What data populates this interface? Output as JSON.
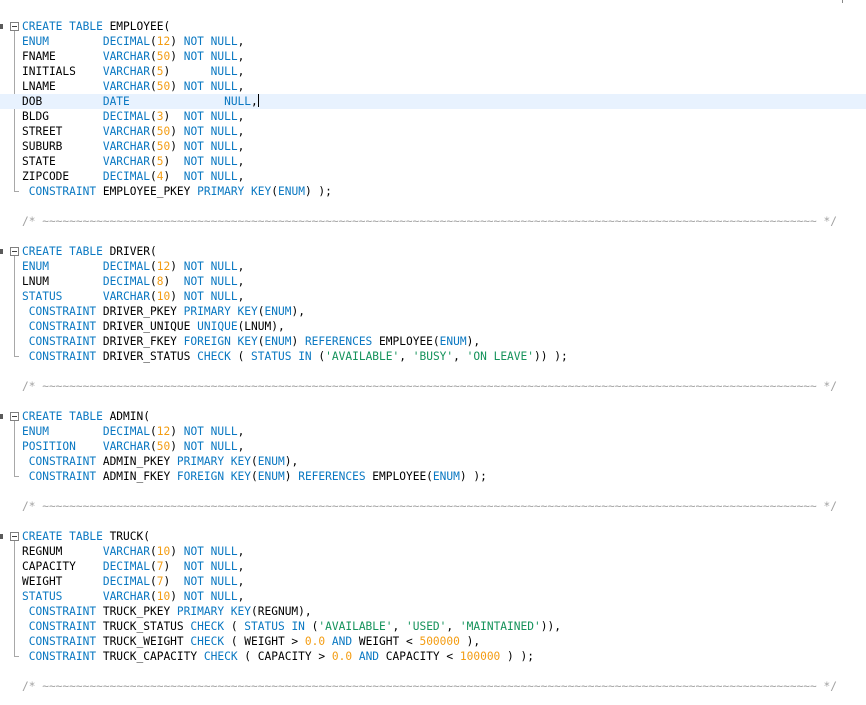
{
  "editor": {
    "language": "sql",
    "colors": {
      "keyword": "#0a78c2",
      "number": "#f39c12",
      "string": "#14925a",
      "comment": "#a0a0a0",
      "current_line": "#e8f2fe",
      "text": "#000000",
      "background": "#ffffff"
    },
    "cursor": {
      "line": 6,
      "after_text": "NOT NULL,"
    },
    "lines": [
      [
        [
          "CREATE TABLE",
          "kw"
        ],
        [
          " EMPLOYEE(",
          ""
        ]
      ],
      [
        [
          "ENUM        ",
          "kw"
        ],
        [
          "DECIMAL",
          "kw"
        ],
        [
          "(",
          ""
        ],
        [
          "12",
          "num"
        ],
        [
          ") ",
          ""
        ],
        [
          "NOT NULL",
          "kw"
        ],
        [
          ",",
          ""
        ]
      ],
      [
        [
          "FNAME       ",
          ""
        ],
        [
          "VARCHAR",
          "kw"
        ],
        [
          "(",
          ""
        ],
        [
          "50",
          "num"
        ],
        [
          ") ",
          ""
        ],
        [
          "NOT NULL",
          "kw"
        ],
        [
          ",",
          ""
        ]
      ],
      [
        [
          "INITIALS    ",
          ""
        ],
        [
          "VARCHAR",
          "kw"
        ],
        [
          "(",
          ""
        ],
        [
          "5",
          "num"
        ],
        [
          ")      ",
          ""
        ],
        [
          "NULL",
          "kw"
        ],
        [
          ",",
          ""
        ]
      ],
      [
        [
          "LNAME       ",
          ""
        ],
        [
          "VARCHAR",
          "kw"
        ],
        [
          "(",
          ""
        ],
        [
          "50",
          "num"
        ],
        [
          ") ",
          ""
        ],
        [
          "NOT NULL",
          "kw"
        ],
        [
          ",",
          ""
        ]
      ],
      [
        [
          "DOB         ",
          ""
        ],
        [
          "DATE",
          "kw"
        ],
        [
          "              ",
          ""
        ],
        [
          "NULL",
          "kw"
        ],
        [
          ",",
          ""
        ]
      ],
      [
        [
          "BLDG        ",
          ""
        ],
        [
          "DECIMAL",
          "kw"
        ],
        [
          "(",
          ""
        ],
        [
          "3",
          "num"
        ],
        [
          ")  ",
          ""
        ],
        [
          "NOT NULL",
          "kw"
        ],
        [
          ",",
          ""
        ]
      ],
      [
        [
          "STREET      ",
          ""
        ],
        [
          "VARCHAR",
          "kw"
        ],
        [
          "(",
          ""
        ],
        [
          "50",
          "num"
        ],
        [
          ") ",
          ""
        ],
        [
          "NOT NULL",
          "kw"
        ],
        [
          ",",
          ""
        ]
      ],
      [
        [
          "SUBURB      ",
          ""
        ],
        [
          "VARCHAR",
          "kw"
        ],
        [
          "(",
          ""
        ],
        [
          "50",
          "num"
        ],
        [
          ") ",
          ""
        ],
        [
          "NOT NULL",
          "kw"
        ],
        [
          ",",
          ""
        ]
      ],
      [
        [
          "STATE       ",
          ""
        ],
        [
          "VARCHAR",
          "kw"
        ],
        [
          "(",
          ""
        ],
        [
          "5",
          "num"
        ],
        [
          ")  ",
          ""
        ],
        [
          "NOT NULL",
          "kw"
        ],
        [
          ",",
          ""
        ]
      ],
      [
        [
          "ZIPCODE     ",
          ""
        ],
        [
          "DECIMAL",
          "kw"
        ],
        [
          "(",
          ""
        ],
        [
          "4",
          "num"
        ],
        [
          ")  ",
          ""
        ],
        [
          "NOT NULL",
          "kw"
        ],
        [
          ",",
          ""
        ]
      ],
      [
        [
          " CONSTRAINT",
          "kw"
        ],
        [
          " EMPLOYEE_PKEY ",
          ""
        ],
        [
          "PRIMARY KEY",
          "kw"
        ],
        [
          "(",
          ""
        ],
        [
          "ENUM",
          "kw"
        ],
        [
          ") );",
          ""
        ]
      ],
      [],
      [
        [
          "/* ~~~~~~~~~~~~~~~~~~~~~~~~~~~~~~~~~~~~~~~~~~~~~~~~~~~~~~~~~~~~~~~~~~~~~~~~~~~~~~~~~~~~~~~~~~~~~~~~~~~~~~~~~~~~~~~~~~~ */",
          "cmt"
        ]
      ],
      [],
      [
        [
          "CREATE TABLE",
          "kw"
        ],
        [
          " DRIVER(",
          ""
        ]
      ],
      [
        [
          "ENUM        ",
          "kw"
        ],
        [
          "DECIMAL",
          "kw"
        ],
        [
          "(",
          ""
        ],
        [
          "12",
          "num"
        ],
        [
          ") ",
          ""
        ],
        [
          "NOT NULL",
          "kw"
        ],
        [
          ",",
          ""
        ]
      ],
      [
        [
          "LNUM        ",
          ""
        ],
        [
          "DECIMAL",
          "kw"
        ],
        [
          "(",
          ""
        ],
        [
          "8",
          "num"
        ],
        [
          ")  ",
          ""
        ],
        [
          "NOT NULL",
          "kw"
        ],
        [
          ",",
          ""
        ]
      ],
      [
        [
          "STATUS      ",
          "kw"
        ],
        [
          "VARCHAR",
          "kw"
        ],
        [
          "(",
          ""
        ],
        [
          "10",
          "num"
        ],
        [
          ") ",
          ""
        ],
        [
          "NOT NULL",
          "kw"
        ],
        [
          ",",
          ""
        ]
      ],
      [
        [
          " CONSTRAINT",
          "kw"
        ],
        [
          " DRIVER_PKEY ",
          ""
        ],
        [
          "PRIMARY KEY",
          "kw"
        ],
        [
          "(",
          ""
        ],
        [
          "ENUM",
          "kw"
        ],
        [
          "),",
          ""
        ]
      ],
      [
        [
          " CONSTRAINT",
          "kw"
        ],
        [
          " DRIVER_UNIQUE ",
          ""
        ],
        [
          "UNIQUE",
          "kw"
        ],
        [
          "(LNUM),",
          ""
        ]
      ],
      [
        [
          " CONSTRAINT",
          "kw"
        ],
        [
          " DRIVER_FKEY ",
          ""
        ],
        [
          "FOREIGN KEY",
          "kw"
        ],
        [
          "(",
          ""
        ],
        [
          "ENUM",
          "kw"
        ],
        [
          ") ",
          ""
        ],
        [
          "REFERENCES",
          "kw"
        ],
        [
          " EMPLOYEE(",
          ""
        ],
        [
          "ENUM",
          "kw"
        ],
        [
          "),",
          ""
        ]
      ],
      [
        [
          " CONSTRAINT",
          "kw"
        ],
        [
          " DRIVER_STATUS ",
          ""
        ],
        [
          "CHECK",
          "kw"
        ],
        [
          " ( ",
          ""
        ],
        [
          "STATUS IN",
          "kw"
        ],
        [
          " (",
          ""
        ],
        [
          "'AVAILABLE'",
          "str"
        ],
        [
          ", ",
          ""
        ],
        [
          "'BUSY'",
          "str"
        ],
        [
          ", ",
          ""
        ],
        [
          "'ON LEAVE'",
          "str"
        ],
        [
          ")) );",
          ""
        ]
      ],
      [],
      [
        [
          "/* ~~~~~~~~~~~~~~~~~~~~~~~~~~~~~~~~~~~~~~~~~~~~~~~~~~~~~~~~~~~~~~~~~~~~~~~~~~~~~~~~~~~~~~~~~~~~~~~~~~~~~~~~~~~~~~~~~~~ */",
          "cmt"
        ]
      ],
      [],
      [
        [
          "CREATE TABLE",
          "kw"
        ],
        [
          " ADMIN(",
          ""
        ]
      ],
      [
        [
          "ENUM        ",
          "kw"
        ],
        [
          "DECIMAL",
          "kw"
        ],
        [
          "(",
          ""
        ],
        [
          "12",
          "num"
        ],
        [
          ") ",
          ""
        ],
        [
          "NOT NULL",
          "kw"
        ],
        [
          ",",
          ""
        ]
      ],
      [
        [
          "POSITION    ",
          "kw"
        ],
        [
          "VARCHAR",
          "kw"
        ],
        [
          "(",
          ""
        ],
        [
          "50",
          "num"
        ],
        [
          ") ",
          ""
        ],
        [
          "NOT NULL",
          "kw"
        ],
        [
          ",",
          ""
        ]
      ],
      [
        [
          " CONSTRAINT",
          "kw"
        ],
        [
          " ADMIN_PKEY ",
          ""
        ],
        [
          "PRIMARY KEY",
          "kw"
        ],
        [
          "(",
          ""
        ],
        [
          "ENUM",
          "kw"
        ],
        [
          "),",
          ""
        ]
      ],
      [
        [
          " CONSTRAINT",
          "kw"
        ],
        [
          " ADMIN_FKEY ",
          ""
        ],
        [
          "FOREIGN KEY",
          "kw"
        ],
        [
          "(",
          ""
        ],
        [
          "ENUM",
          "kw"
        ],
        [
          ") ",
          ""
        ],
        [
          "REFERENCES",
          "kw"
        ],
        [
          " EMPLOYEE(",
          ""
        ],
        [
          "ENUM",
          "kw"
        ],
        [
          ") );",
          ""
        ]
      ],
      [],
      [
        [
          "/* ~~~~~~~~~~~~~~~~~~~~~~~~~~~~~~~~~~~~~~~~~~~~~~~~~~~~~~~~~~~~~~~~~~~~~~~~~~~~~~~~~~~~~~~~~~~~~~~~~~~~~~~~~~~~~~~~~~~ */",
          "cmt"
        ]
      ],
      [],
      [
        [
          "CREATE TABLE",
          "kw"
        ],
        [
          " TRUCK(",
          ""
        ]
      ],
      [
        [
          "REGNUM      ",
          ""
        ],
        [
          "VARCHAR",
          "kw"
        ],
        [
          "(",
          ""
        ],
        [
          "10",
          "num"
        ],
        [
          ") ",
          ""
        ],
        [
          "NOT NULL",
          "kw"
        ],
        [
          ",",
          ""
        ]
      ],
      [
        [
          "CAPACITY    ",
          ""
        ],
        [
          "DECIMAL",
          "kw"
        ],
        [
          "(",
          ""
        ],
        [
          "7",
          "num"
        ],
        [
          ")  ",
          ""
        ],
        [
          "NOT NULL",
          "kw"
        ],
        [
          ",",
          ""
        ]
      ],
      [
        [
          "WEIGHT      ",
          ""
        ],
        [
          "DECIMAL",
          "kw"
        ],
        [
          "(",
          ""
        ],
        [
          "7",
          "num"
        ],
        [
          ")  ",
          ""
        ],
        [
          "NOT NULL",
          "kw"
        ],
        [
          ",",
          ""
        ]
      ],
      [
        [
          "STATUS      ",
          "kw"
        ],
        [
          "VARCHAR",
          "kw"
        ],
        [
          "(",
          ""
        ],
        [
          "10",
          "num"
        ],
        [
          ") ",
          ""
        ],
        [
          "NOT NULL",
          "kw"
        ],
        [
          ",",
          ""
        ]
      ],
      [
        [
          " CONSTRAINT",
          "kw"
        ],
        [
          " TRUCK_PKEY ",
          ""
        ],
        [
          "PRIMARY KEY",
          "kw"
        ],
        [
          "(REGNUM),",
          ""
        ]
      ],
      [
        [
          " CONSTRAINT",
          "kw"
        ],
        [
          " TRUCK_STATUS ",
          ""
        ],
        [
          "CHECK",
          "kw"
        ],
        [
          " ( ",
          ""
        ],
        [
          "STATUS IN",
          "kw"
        ],
        [
          " (",
          ""
        ],
        [
          "'AVAILABLE'",
          "str"
        ],
        [
          ", ",
          ""
        ],
        [
          "'USED'",
          "str"
        ],
        [
          ", ",
          ""
        ],
        [
          "'MAINTAINED'",
          "str"
        ],
        [
          ")),",
          ""
        ]
      ],
      [
        [
          " CONSTRAINT",
          "kw"
        ],
        [
          " TRUCK_WEIGHT ",
          ""
        ],
        [
          "CHECK",
          "kw"
        ],
        [
          " ( WEIGHT > ",
          ""
        ],
        [
          "0.0",
          "num"
        ],
        [
          " ",
          ""
        ],
        [
          "AND",
          "kw"
        ],
        [
          " WEIGHT < ",
          ""
        ],
        [
          "500000",
          "num"
        ],
        [
          " ),",
          ""
        ]
      ],
      [
        [
          " CONSTRAINT",
          "kw"
        ],
        [
          " TRUCK_CAPACITY ",
          ""
        ],
        [
          "CHECK",
          "kw"
        ],
        [
          " ( CAPACITY > ",
          ""
        ],
        [
          "0.0",
          "num"
        ],
        [
          " ",
          ""
        ],
        [
          "AND",
          "kw"
        ],
        [
          " CAPACITY < ",
          ""
        ],
        [
          "100000",
          "num"
        ],
        [
          " ) );",
          ""
        ]
      ],
      [],
      [
        [
          "/* ~~~~~~~~~~~~~~~~~~~~~~~~~~~~~~~~~~~~~~~~~~~~~~~~~~~~~~~~~~~~~~~~~~~~~~~~~~~~~~~~~~~~~~~~~~~~~~~~~~~~~~~~~~~~~~~~~~~ */",
          "cmt"
        ]
      ]
    ]
  }
}
